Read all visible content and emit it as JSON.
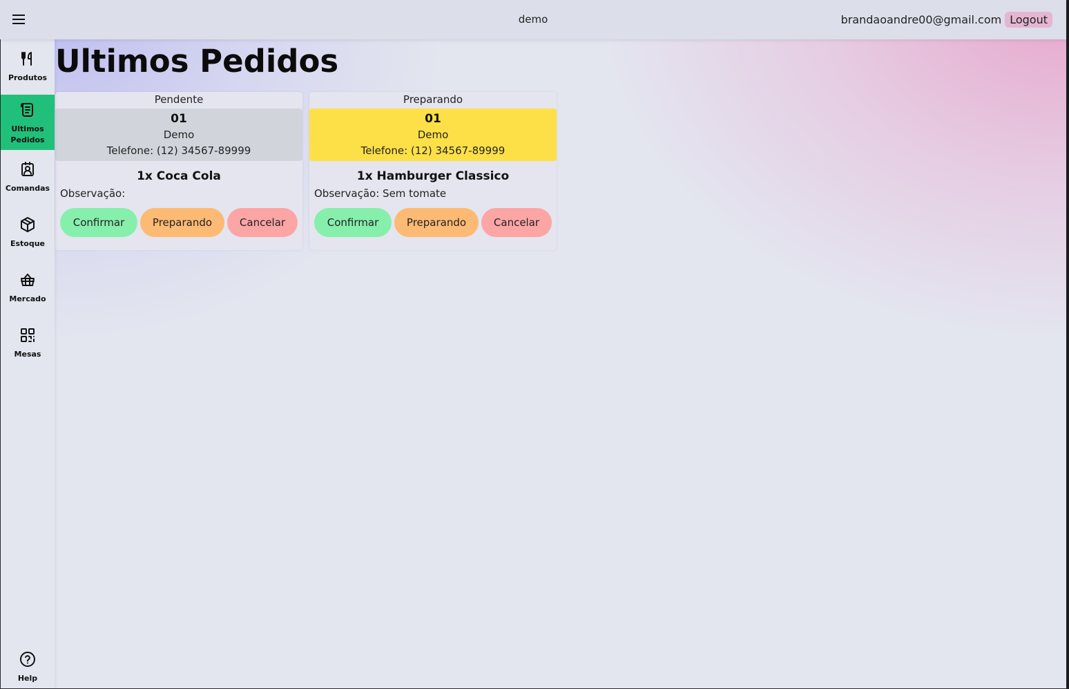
{
  "topbar": {
    "app_name": "demo",
    "user_email": "brandaoandre00@gmail.com",
    "logout_label": "Logout"
  },
  "sidebar": {
    "items": [
      {
        "label": "Produtos",
        "icon": "utensils-icon"
      },
      {
        "label": "Ultimos Pedidos",
        "icon": "receipt-icon",
        "active": true
      },
      {
        "label": "Comandas",
        "icon": "user-card-icon"
      },
      {
        "label": "Estoque",
        "icon": "box-icon"
      },
      {
        "label": "Mercado",
        "icon": "basket-icon"
      },
      {
        "label": "Mesas",
        "icon": "qrcode-icon"
      }
    ],
    "help_label": "Help"
  },
  "page": {
    "title": "Ultimos Pedidos"
  },
  "orders": [
    {
      "status": "Pendente",
      "number": "01",
      "client": "Demo",
      "phone": "Telefone: (12) 34567-89999",
      "item": "1x Coca Cola",
      "observation": "Observação:",
      "header_color": "#d1d5db"
    },
    {
      "status": "Preparando",
      "number": "01",
      "client": "Demo",
      "phone": "Telefone: (12) 34567-89999",
      "item": "1x Hamburger Classico",
      "observation": "Observação: Sem tomate",
      "header_color": "#fde047"
    }
  ],
  "actions": {
    "confirm_label": "Confirmar",
    "preparing_label": "Preparando",
    "cancel_label": "Cancelar"
  },
  "colors": {
    "active_nav": "#21c07a",
    "confirm": "#86efac",
    "preparing": "#fdba74",
    "cancel": "#fca5a5",
    "logout": "#e4b6d1"
  }
}
